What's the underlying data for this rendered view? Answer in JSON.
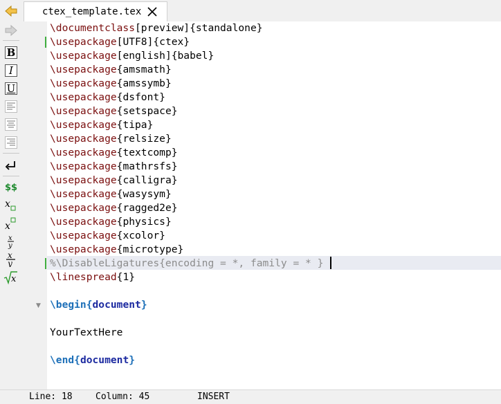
{
  "tab": {
    "title": "ctex_template.tex"
  },
  "toolbar": {
    "bold": "B",
    "italic": "I",
    "underline": "U",
    "dollars": "$$"
  },
  "editor": {
    "lines": [
      {
        "cmd": "\\documentclass",
        "arg": "[preview]{standalone}"
      },
      {
        "cmd": "\\usepackage",
        "arg": "[UTF8]{ctex}"
      },
      {
        "cmd": "\\usepackage",
        "arg": "[english]{babel}"
      },
      {
        "cmd": "\\usepackage",
        "arg": "{amsmath}"
      },
      {
        "cmd": "\\usepackage",
        "arg": "{amssymb}"
      },
      {
        "cmd": "\\usepackage",
        "arg": "{dsfont}"
      },
      {
        "cmd": "\\usepackage",
        "arg": "{setspace}"
      },
      {
        "cmd": "\\usepackage",
        "arg": "{tipa}"
      },
      {
        "cmd": "\\usepackage",
        "arg": "{relsize}"
      },
      {
        "cmd": "\\usepackage",
        "arg": "{textcomp}"
      },
      {
        "cmd": "\\usepackage",
        "arg": "{mathrsfs}"
      },
      {
        "cmd": "\\usepackage",
        "arg": "{calligra}"
      },
      {
        "cmd": "\\usepackage",
        "arg": "{wasysym}"
      },
      {
        "cmd": "\\usepackage",
        "arg": "{ragged2e}"
      },
      {
        "cmd": "\\usepackage",
        "arg": "{physics}"
      },
      {
        "cmd": "\\usepackage",
        "arg": "{xcolor}"
      },
      {
        "cmd": "\\usepackage",
        "arg": "{microtype}"
      }
    ],
    "comment_line": "%\\DisableLigatures{encoding = *, family = * }",
    "linespread": {
      "cmd": "\\linespread",
      "arg": "{1}"
    },
    "begin": {
      "cmd": "\\begin",
      "open": "{",
      "env": "document",
      "close": "}"
    },
    "body_text": "YourTextHere",
    "end": {
      "cmd": "\\end",
      "open": "{",
      "env": "document",
      "close": "}"
    }
  },
  "status": {
    "line": "Line: 18",
    "column": "Column: 45",
    "mode": "INSERT"
  },
  "colors": {
    "command": "#7a0e0e",
    "comment": "#8c8c8c",
    "env_command": "#1c6fb8",
    "env_name": "#1c2aa0",
    "change_marker": "#3fae3f",
    "current_line": "#e9ebf2"
  }
}
